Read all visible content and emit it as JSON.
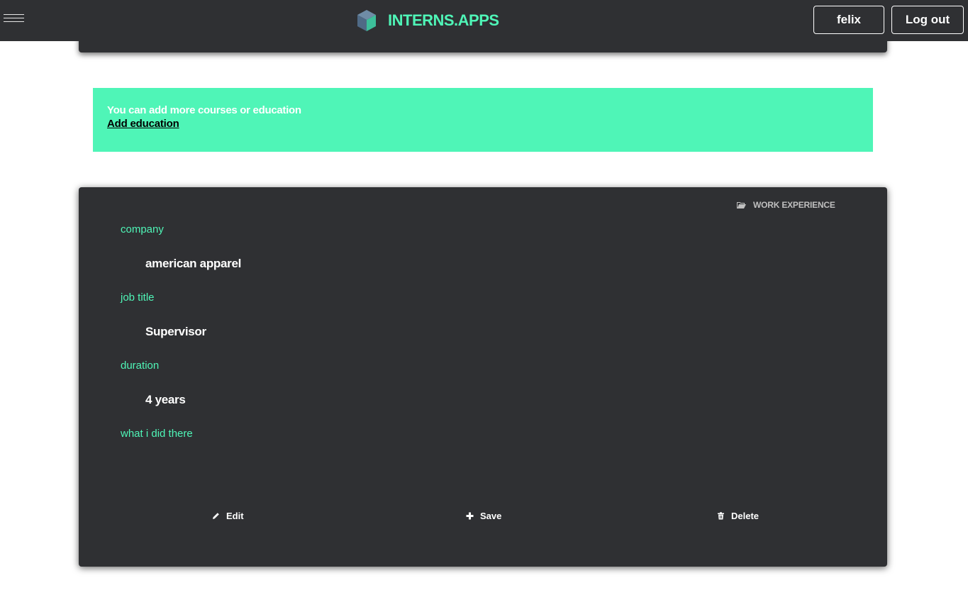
{
  "header": {
    "menu_icon": "hamburger-icon",
    "logo_icon": "cube-icon",
    "brand": "INTERNS.APPS",
    "user_label": "felix",
    "logout_label": "Log out",
    "brand_color": "#4ff5b7",
    "bar_color": "#2f3033"
  },
  "notice": {
    "message": "You can add more courses or education",
    "link_label": "Add education",
    "background": "#4ff5b7"
  },
  "work_card": {
    "section_icon": "folder-open-icon",
    "section_title": "WORK EXPERIENCE",
    "fields": [
      {
        "label": "company",
        "value": "american apparel"
      },
      {
        "label": "job title",
        "value": "Supervisor"
      },
      {
        "label": "duration",
        "value": "4 years"
      },
      {
        "label": "what i did there",
        "value": ""
      }
    ],
    "actions": {
      "edit": {
        "label": "Edit",
        "icon": "pencil-icon"
      },
      "save": {
        "label": "Save",
        "icon": "plus-icon"
      },
      "delete": {
        "label": "Delete",
        "icon": "trash-icon"
      }
    }
  }
}
